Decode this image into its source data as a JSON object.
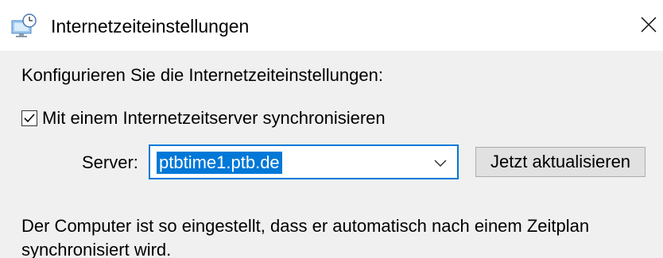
{
  "window": {
    "title": "Internetzeiteinstellungen",
    "icon": "clock-globe-icon",
    "close_icon": "close-icon"
  },
  "content": {
    "intro": "Konfigurieren Sie die Internetzeiteinstellungen:",
    "sync_checkbox": {
      "label": "Mit einem Internetzeitserver synchronisieren",
      "checked": true
    },
    "server": {
      "label": "Server:",
      "value": "ptbtime1.ptb.de",
      "dropdown_icon": "chevron-down-icon"
    },
    "update_button": "Jetzt aktualisieren",
    "status": "Der Computer ist so eingestellt, dass er automatisch nach einem Zeitplan synchronisiert wird."
  },
  "colors": {
    "accent": "#0078d7",
    "panel_background": "#f0f0f0",
    "button_background": "#e1e1e1"
  }
}
